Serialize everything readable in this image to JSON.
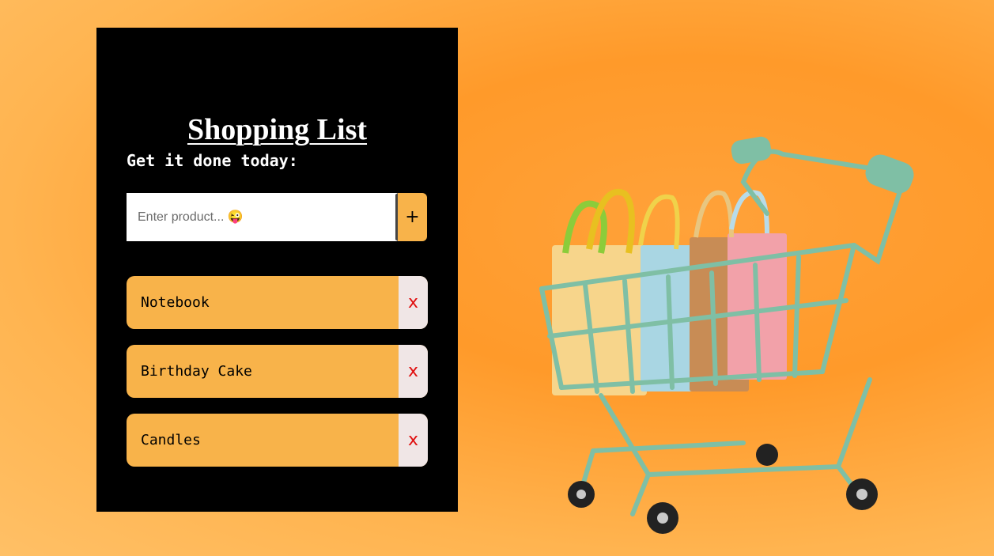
{
  "app": {
    "title": "Shopping List",
    "subtitle": "Get it done today:"
  },
  "add_form": {
    "placeholder": "Enter product... 😜",
    "value": "",
    "add_label": "+"
  },
  "items": [
    {
      "label": "Notebook",
      "delete_label": "x"
    },
    {
      "label": "Birthday Cake",
      "delete_label": "x"
    },
    {
      "label": "Candles",
      "delete_label": "x"
    }
  ],
  "colors": {
    "background": "#ff9f32",
    "card": "#000000",
    "accent": "#f8b34a",
    "delete_bg": "#f0e6e6",
    "delete_text": "#e01010"
  },
  "decor": {
    "hero_image": "shopping-cart-with-bags-icon"
  }
}
